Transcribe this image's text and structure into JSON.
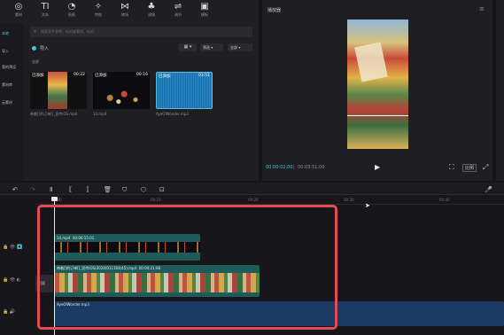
{
  "toolbar": {
    "items": [
      {
        "icon": "media-icon",
        "glyph": "◎",
        "label": "素材"
      },
      {
        "icon": "text-icon",
        "glyph": "TI",
        "label": "文本"
      },
      {
        "icon": "sticker-icon",
        "glyph": "◔",
        "label": "贴纸"
      },
      {
        "icon": "effects-icon",
        "glyph": "✧",
        "label": "特效"
      },
      {
        "icon": "transition-icon",
        "glyph": "⋈",
        "label": "转场"
      },
      {
        "icon": "filter-icon",
        "glyph": "♣",
        "label": "滤镜"
      },
      {
        "icon": "adjust-icon",
        "glyph": "⇌",
        "label": "调节"
      },
      {
        "icon": "template-icon",
        "glyph": "▣",
        "label": "模板"
      }
    ]
  },
  "sidebar": {
    "items": [
      {
        "label": "本地"
      },
      {
        "label": "导入"
      },
      {
        "label": "我的预设"
      },
      {
        "label": "素材库"
      },
      {
        "label": "云素材"
      }
    ]
  },
  "media": {
    "search_placeholder": "搜索文件名称、标识或素材、标识",
    "import_label": "导入",
    "sort_label": "筛选",
    "view_label": "全部",
    "folder_label": "全部",
    "items": [
      {
        "tag": "已添加",
        "duration": "00:22",
        "caption": "带着[]的订单[]_宣传iOS.mp4"
      },
      {
        "tag": "已添加",
        "duration": "00:16",
        "caption": "14.mp4"
      },
      {
        "tag": "已添加",
        "duration": "03:51",
        "caption": "AyeOlWonder.mp3"
      }
    ]
  },
  "player": {
    "title": "播放器",
    "time_current": "00:00:02:00",
    "time_total": "00:03:51:00",
    "ratio_label": "比例"
  },
  "timeline": {
    "ticks": [
      "00:00",
      "00:10",
      "00:20",
      "00:30",
      "00:40"
    ],
    "clips": [
      {
        "label": "14.mp4",
        "duration": "00:00:15:01"
      },
      {
        "label": "带着[]的订单[]_宣传iOS(2024)011164(45).mp4",
        "duration": "00:00:21:08"
      },
      {
        "label": "AyeOlWonder.mp3"
      }
    ],
    "cover_label": "封面"
  },
  "colors": {
    "accent": "#4fc3d9",
    "video_clip": "#1d5c5a",
    "audio_clip": "#1b3a64",
    "highlight_box": "#e24a57"
  }
}
